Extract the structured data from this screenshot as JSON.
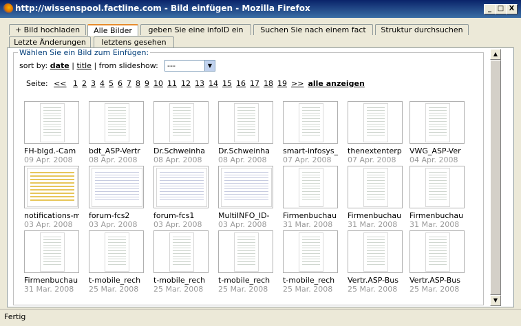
{
  "window": {
    "title": "http://wissenspool.factline.com - Bild einfügen - Mozilla Firefox",
    "controls": [
      "_",
      "□",
      "X"
    ]
  },
  "tabs_row1": [
    "+ Bild hochladen",
    "Alle Bilder",
    "geben Sie eine infoID ein",
    "Suchen Sie nach einem fact",
    "Struktur durchsuchen"
  ],
  "tabs_row2": [
    "Letzte Änderungen",
    "letztens gesehen"
  ],
  "active_tab": "Alle Bilder",
  "section": {
    "legend": "Wählen Sie ein Bild zum Einfügen:",
    "sort_label": "sort by:",
    "sort_date": "date",
    "sort_sep1": "|",
    "sort_title": "title",
    "sort_sep2": "| from slideshow:",
    "slideshow_value": "---"
  },
  "pager": {
    "label": "Seite:",
    "prev": "<<",
    "pages": [
      "1",
      "2",
      "3",
      "4",
      "5",
      "6",
      "7",
      "8",
      "9",
      "10",
      "11",
      "12",
      "13",
      "14",
      "15",
      "16",
      "17",
      "18",
      "19"
    ],
    "next": ">>",
    "all": "alle anzeigen"
  },
  "thumbnails": [
    {
      "name": "FH-blgd.-Cam",
      "date": "09 Apr. 2008",
      "kind": "doc"
    },
    {
      "name": "bdt_ASP-Vertr",
      "date": "08 Apr. 2008",
      "kind": "doc"
    },
    {
      "name": "Dr.Schweinha",
      "date": "08 Apr. 2008",
      "kind": "doc"
    },
    {
      "name": "Dr.Schweinha",
      "date": "08 Apr. 2008",
      "kind": "doc"
    },
    {
      "name": "smart-infosys_",
      "date": "07 Apr. 2008",
      "kind": "doc"
    },
    {
      "name": "thenextenterp",
      "date": "07 Apr. 2008",
      "kind": "doc"
    },
    {
      "name": "VWG_ASP-Ver",
      "date": "04 Apr. 2008",
      "kind": "doc"
    },
    {
      "name": "notifications-m",
      "date": "03 Apr. 2008",
      "kind": "yellow"
    },
    {
      "name": "forum-fcs2",
      "date": "03 Apr. 2008",
      "kind": "screen"
    },
    {
      "name": "forum-fcs1",
      "date": "03 Apr. 2008",
      "kind": "screen"
    },
    {
      "name": "MultiINFO_ID-",
      "date": "03 Apr. 2008",
      "kind": "screen"
    },
    {
      "name": "Firmenbuchau",
      "date": "31 Mar. 2008",
      "kind": "doc"
    },
    {
      "name": "Firmenbuchau",
      "date": "31 Mar. 2008",
      "kind": "doc"
    },
    {
      "name": "Firmenbuchau",
      "date": "31 Mar. 2008",
      "kind": "doc"
    },
    {
      "name": "Firmenbuchau",
      "date": "31 Mar. 2008",
      "kind": "doc"
    },
    {
      "name": "t-mobile_rech",
      "date": "25 Mar. 2008",
      "kind": "doc"
    },
    {
      "name": "t-mobile_rech",
      "date": "25 Mar. 2008",
      "kind": "doc"
    },
    {
      "name": "t-mobile_rech",
      "date": "25 Mar. 2008",
      "kind": "doc"
    },
    {
      "name": "t-mobile_rech",
      "date": "25 Mar. 2008",
      "kind": "doc"
    },
    {
      "name": "Vertr.ASP-Bus",
      "date": "25 Mar. 2008",
      "kind": "doc"
    },
    {
      "name": "Vertr.ASP-Bus",
      "date": "25 Mar. 2008",
      "kind": "doc"
    }
  ],
  "status": "Fertig"
}
